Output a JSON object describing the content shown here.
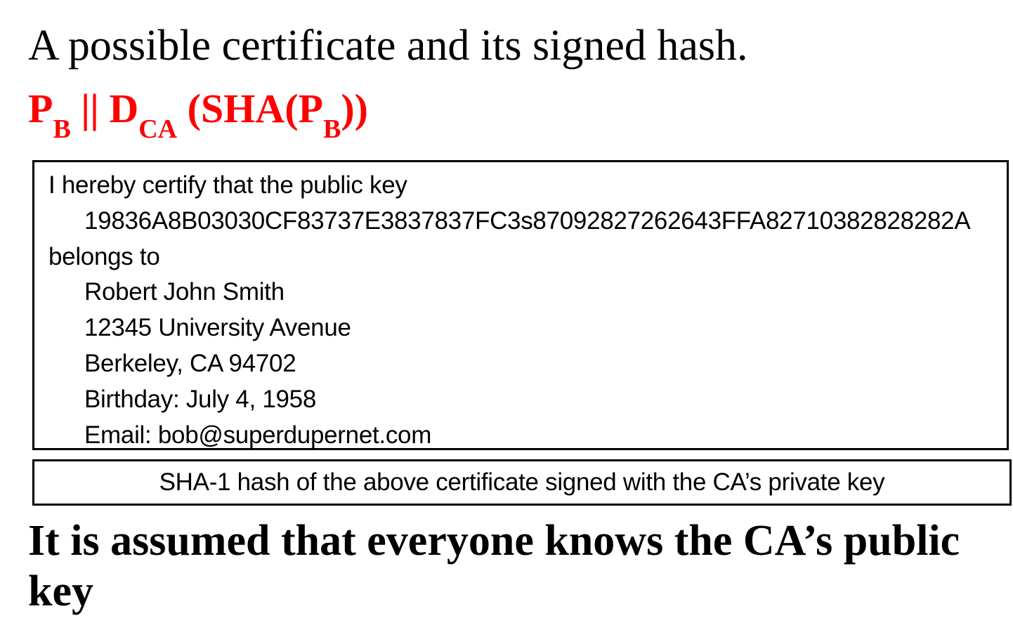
{
  "title": "A possible certificate and its signed hash.",
  "formula": {
    "p": "P",
    "p_sub": "B",
    "concat": " || ",
    "d": "D",
    "d_sub": "CA",
    "sha_open": " (SHA(P",
    "sha_sub": "B",
    "sha_close": "))"
  },
  "certificate": {
    "intro": "I hereby certify that the public key",
    "public_key": "19836A8B03030CF83737E3837837FC3s87092827262643FFA82710382828282A",
    "belongs_to": "belongs to",
    "name": "Robert John Smith",
    "address": "12345 University Avenue",
    "city": "Berkeley, CA 94702",
    "birthday": "Birthday: July 4, 1958",
    "email": "Email: bob@superdupernet.com"
  },
  "signature": {
    "label": "SHA-1 hash of the above certificate signed with the CA’s private key"
  },
  "note": "It is assumed that everyone knows the CA’s public key",
  "colors": {
    "formula": "#ff0000",
    "text": "#000000"
  }
}
